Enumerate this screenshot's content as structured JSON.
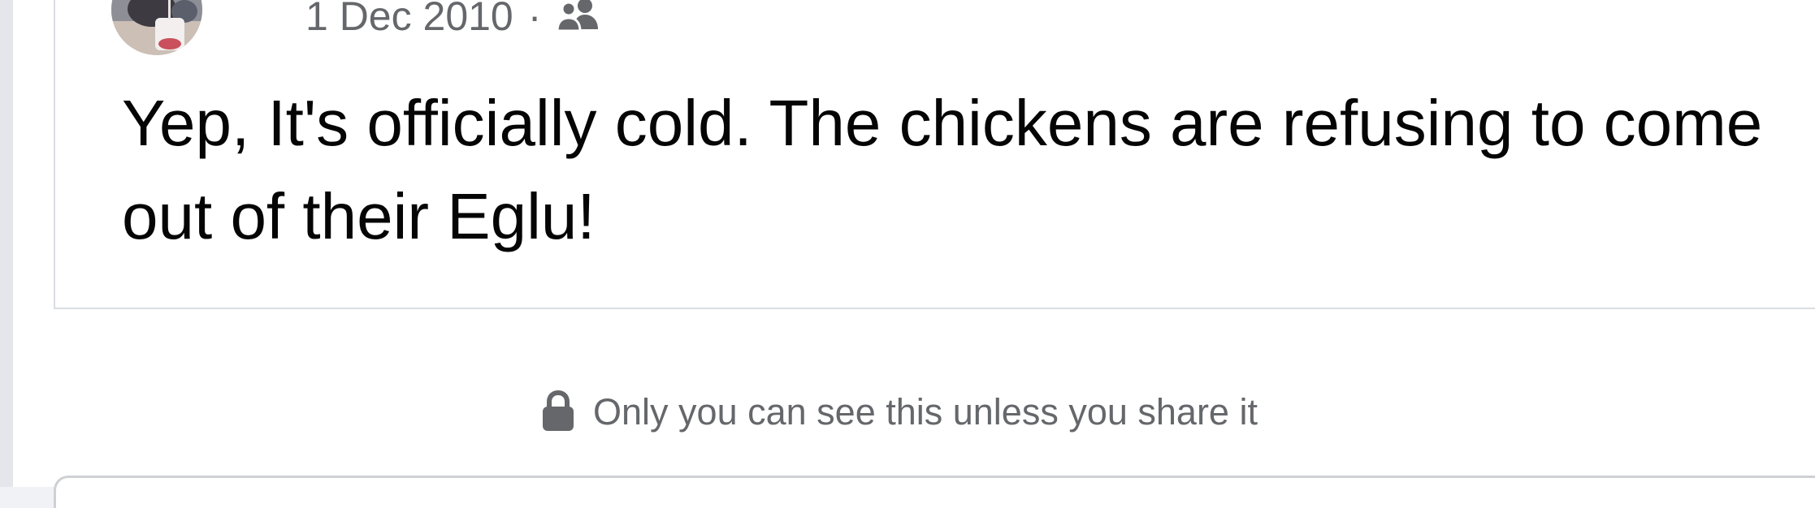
{
  "post": {
    "date": "1 Dec 2010",
    "separator": "·",
    "audience_icon": "friends-icon",
    "text": "Yep, It's officially cold. The chickens are refusing to come out of their Eglu!"
  },
  "privacy": {
    "icon": "lock-icon",
    "note": "Only you can see this unless you share it"
  },
  "colors": {
    "background": "#f0f2f5",
    "card": "#ffffff",
    "text_primary": "#050505",
    "text_secondary": "#65676b",
    "divider": "#dadde1"
  }
}
